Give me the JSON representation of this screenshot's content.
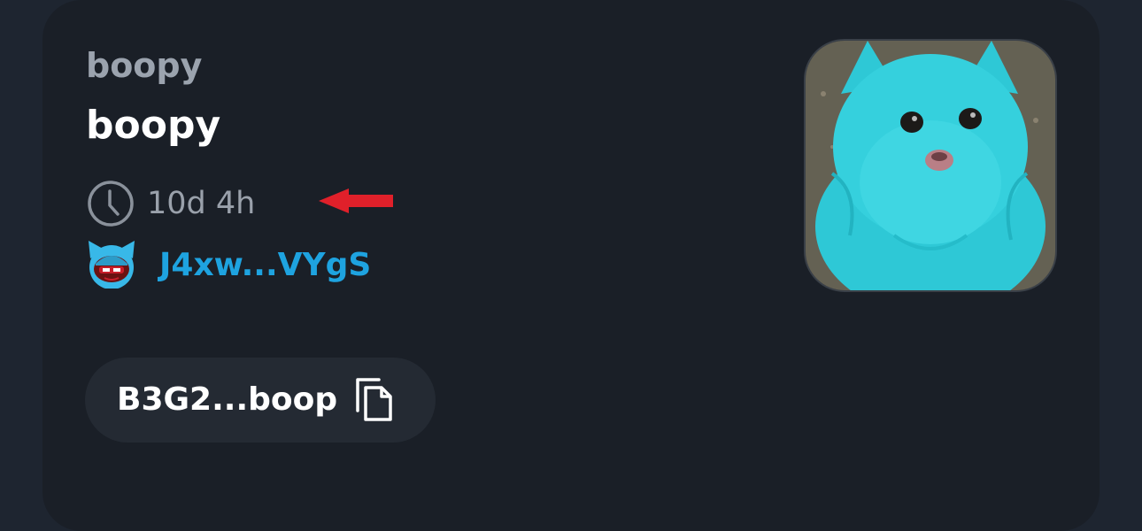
{
  "token": {
    "symbol": "boopy",
    "name": "boopy",
    "age": "10d 4h",
    "creator_short": "J4xw...VYgS",
    "address_short": "B3G2...boop",
    "image_subject": "turquoise-dyed pomeranian dog"
  },
  "icons": {
    "clock": "clock-icon",
    "arrow": "red-arrow-left-icon",
    "avatar": "creator-avatar-icon",
    "copy": "copy-icon"
  },
  "colors": {
    "page_bg": "#1e2530",
    "card_bg": "#1a1f27",
    "pill_bg": "#242a33",
    "symbol_text": "#9ba3ae",
    "link": "#1ea3e0",
    "arrow": "#e0202a",
    "dog_fur": "#2ec8d6"
  }
}
